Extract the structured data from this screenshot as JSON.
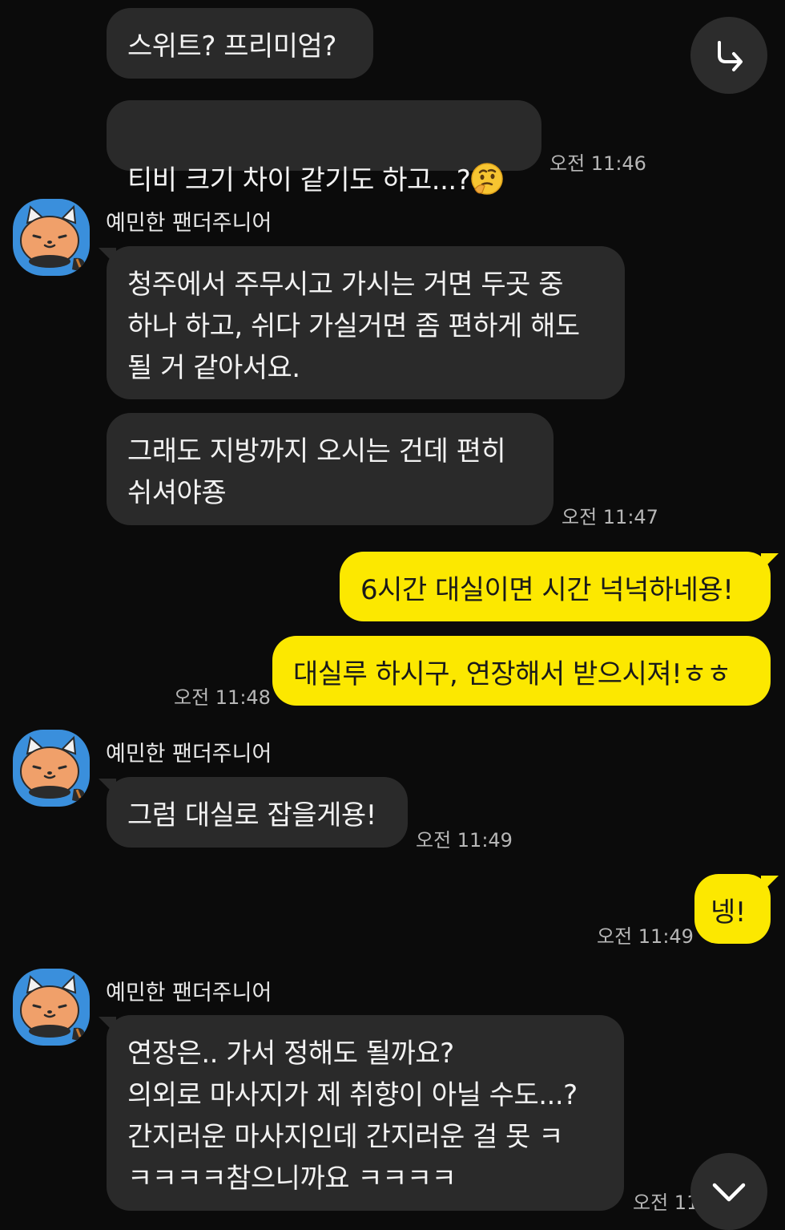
{
  "contact": {
    "name": "예민한 팬더주니어"
  },
  "messages": [
    {
      "side": "in",
      "text": "스위트? 프리미엄?"
    },
    {
      "side": "in",
      "text": "티비 크기 차이 같기도 하고...?",
      "emoji": "thinking-face",
      "time": "오전 11:46"
    },
    {
      "side": "in",
      "sender": "예민한 팬더주니어",
      "text": "청주에서 주무시고 가시는 거면 두곳 중\n하나 하고, 쉬다 가실거면 좀 편하게 해도\n될 거 같아서요."
    },
    {
      "side": "in",
      "text": "그래도 지방까지 오시는 건데 편히\n쉬셔야죵",
      "time": "오전 11:47"
    },
    {
      "side": "out",
      "text": "6시간 대실이면 시간 넉넉하네용!"
    },
    {
      "side": "out",
      "text": "대실루 하시구, 연장해서 받으시져!ㅎㅎ",
      "time": "오전 11:48"
    },
    {
      "side": "in",
      "sender": "예민한 팬더주니어",
      "text": "그럼 대실로 잡을게용!",
      "time": "오전 11:49"
    },
    {
      "side": "out",
      "text": "넹!",
      "time": "오전 11:49"
    },
    {
      "side": "in",
      "sender": "예민한 팬더주니어",
      "text": "연장은.. 가서 정해도 될까요?\n의외로 마사지가 제 취향이 아닐 수도...?\n간지러운 마사지인데 간지러운 걸 못 ㅋ\nㅋㅋㅋㅋ참으니까요 ㅋㅋㅋㅋ",
      "time": "오전 11:49"
    }
  ],
  "icons": {
    "share": "share-arrow-icon",
    "scroll": "chevron-down-icon",
    "avatar": "red-panda-avatar"
  },
  "colors": {
    "background": "#0b0b0b",
    "incoming_bubble": "#2a2a2a",
    "outgoing_bubble": "#fce800",
    "avatar_bg": "#3a8fdc"
  }
}
